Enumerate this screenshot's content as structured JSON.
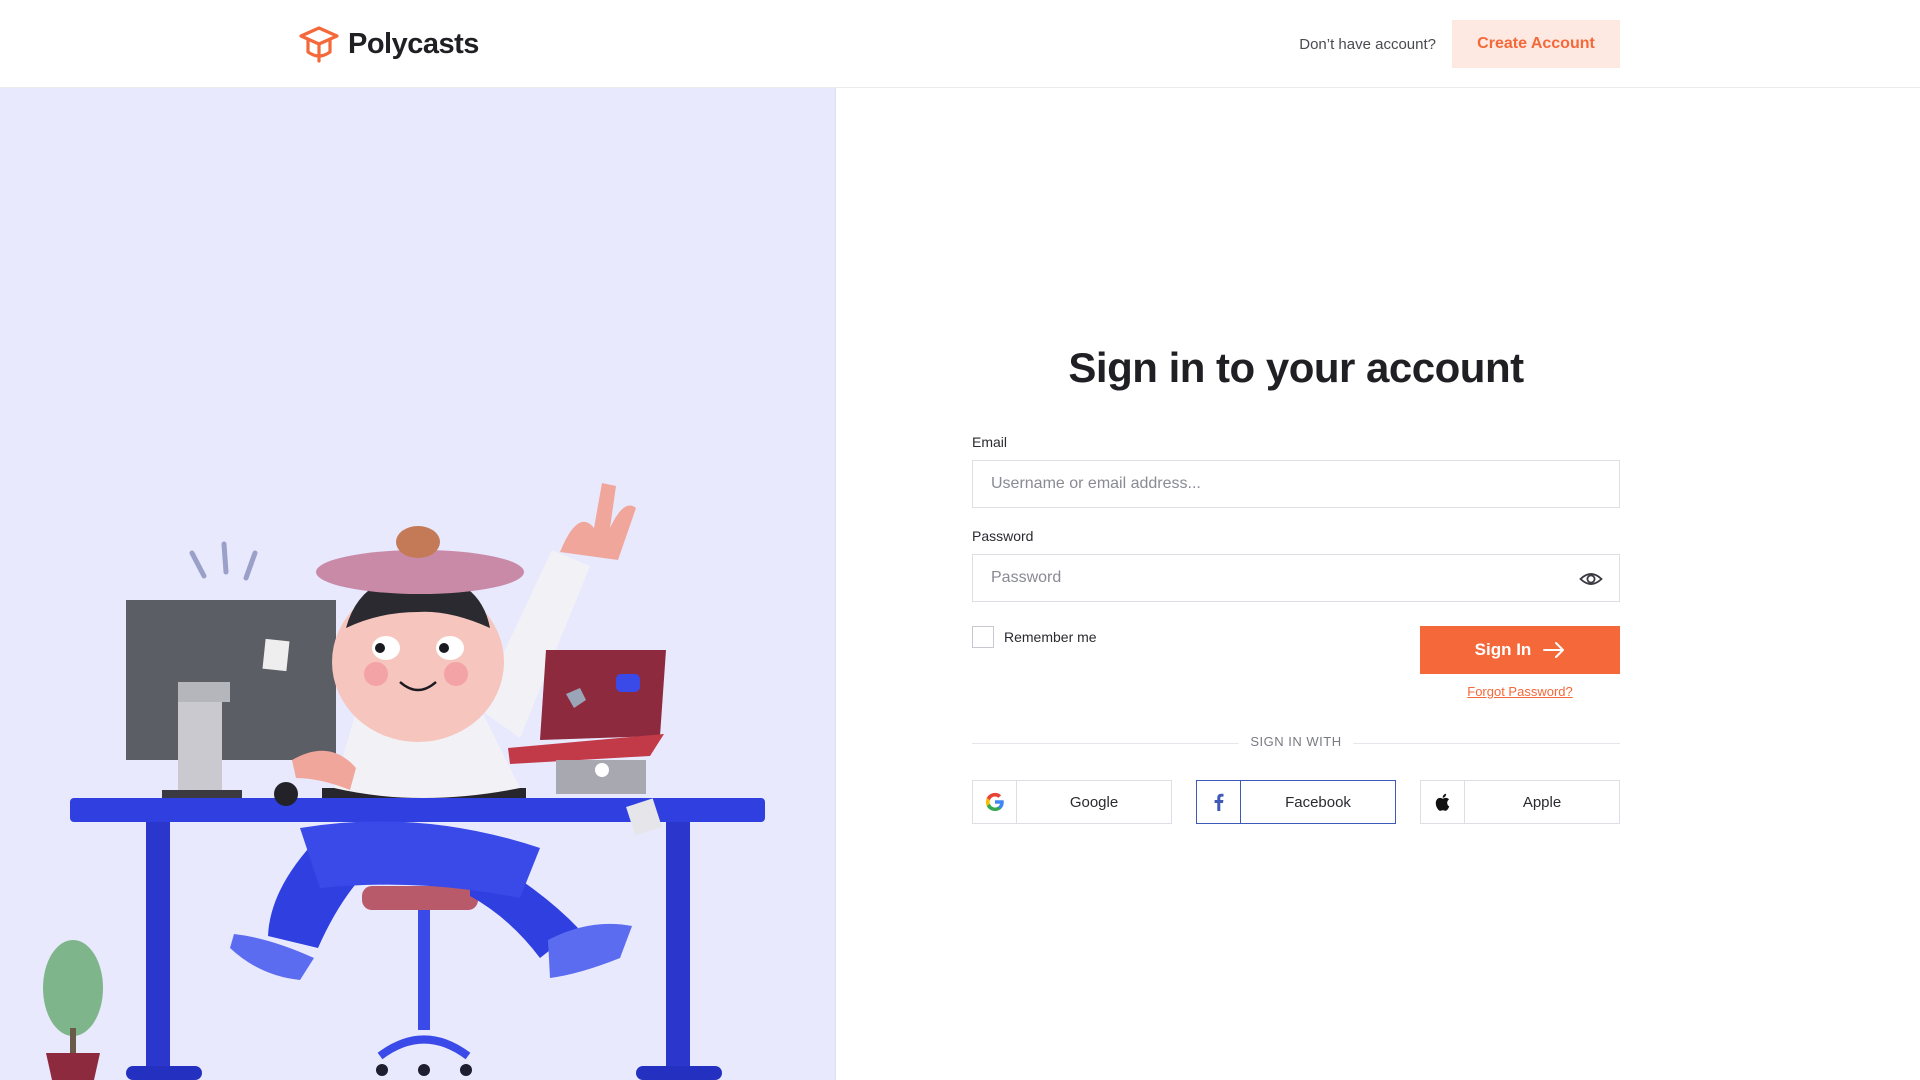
{
  "header": {
    "brand": "Polycasts",
    "no_account_text": "Don’t have account?",
    "create_account_label": "Create Account"
  },
  "form": {
    "title": "Sign in to your account",
    "email_label": "Email",
    "email_placeholder": "Username or email address...",
    "password_label": "Password",
    "password_placeholder": "Password",
    "remember_label": "Remember me",
    "sign_in_label": "Sign In",
    "forgot_label": "Forgot Password?",
    "divider_text": "SIGN IN WITH"
  },
  "social": [
    {
      "label": "Google",
      "icon": "google-icon"
    },
    {
      "label": "Facebook",
      "icon": "facebook-icon"
    },
    {
      "label": "Apple",
      "icon": "apple-icon"
    }
  ],
  "colors": {
    "accent": "#f4683a",
    "accent_light": "#fde9e2",
    "panel_bg": "#e8e9fd",
    "facebook": "#3d5ab8"
  }
}
